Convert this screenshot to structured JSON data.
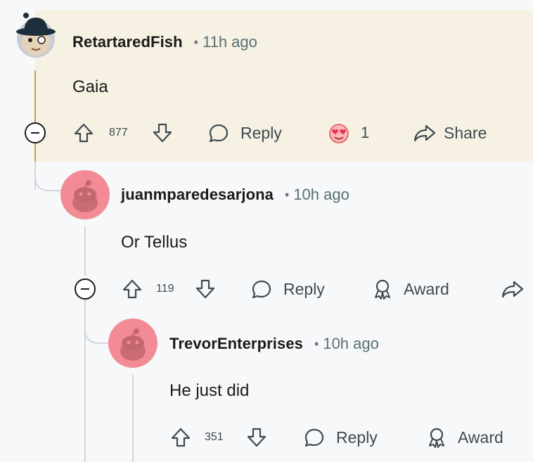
{
  "comments": [
    {
      "author": "RetartaredFish",
      "separator": "•",
      "time": "11h ago",
      "text": "Gaia",
      "score": "877",
      "reply_label": "Reply",
      "award_count": "1",
      "share_label": "Share",
      "highlight_color": "#f6f1e3"
    },
    {
      "author": "juanmparedesarjona",
      "separator": "•",
      "time": "10h ago",
      "text": "Or Tellus",
      "score": "119",
      "reply_label": "Reply",
      "award_label": "Award"
    },
    {
      "author": "TrevorEnterprises",
      "separator": "•",
      "time": "10h ago",
      "text": "He just did",
      "score": "351",
      "reply_label": "Reply",
      "award_label": "Award"
    }
  ],
  "colors": {
    "avatar_pink": "#f28b96",
    "thread_gold": "#c9a23a",
    "thread_gray": "#d2d5d9"
  }
}
